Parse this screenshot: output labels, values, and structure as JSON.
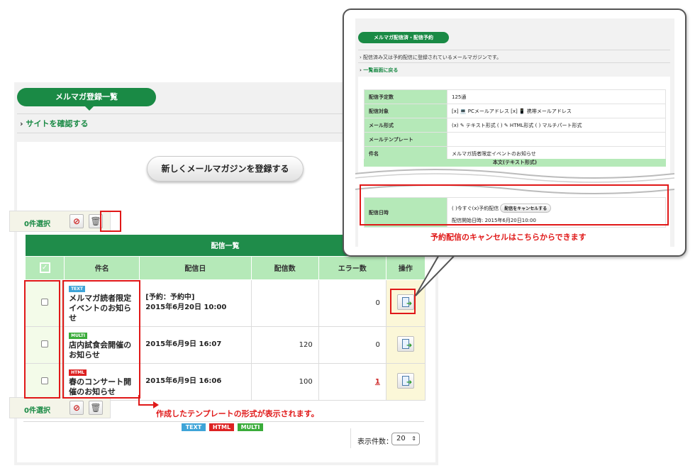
{
  "main": {
    "section_title": "メルマガ登録一覧",
    "site_link": "サイトを確認する",
    "register_button": "新しくメールマガジンを登録する",
    "selected_count_top": "0件選択",
    "selected_count_bottom": "0件選択",
    "table": {
      "title": "配信一覧",
      "headers": {
        "subject": "件名",
        "date": "配信日",
        "count": "配信数",
        "errors": "エラー数",
        "actions": "操作"
      },
      "rows": [
        {
          "badge": "TEXT",
          "subject": "メルマガ読者限定イベントのお知らせ",
          "date_line1": "[予約：予約中]",
          "date_line2": "2015年6月20日 10:00",
          "count": "",
          "errors": "0"
        },
        {
          "badge": "MULTI",
          "subject": "店内試食会開催のお知らせ",
          "date_line1": "2015年6月9日 16:07",
          "count": "120",
          "errors": "0"
        },
        {
          "badge": "HTML",
          "subject": "春のコンサート開催のお知らせ",
          "date_line1": "2015年6月9日 16:06",
          "count": "100",
          "errors": "1"
        }
      ]
    },
    "legend": {
      "text": "TEXT",
      "html": "HTML",
      "multi": "MULTI"
    },
    "page_size_label": "表示件数：",
    "page_size_value": "20",
    "annotation_template": "作成したテンプレートの形式が表示されます。"
  },
  "callout": {
    "section_title": "メルマガ配信済・配信予約",
    "description": "配信済み又は予約配信に登録されているメールマガジンです。",
    "back_link": "一覧画面に戻る",
    "rows": [
      {
        "label": "配信予定数",
        "value": "125通"
      },
      {
        "label": "配信対象",
        "value": "[x] 💻 PCメールアドレス [x] 📱 携帯メールアドレス"
      },
      {
        "label": "メール形式",
        "value": "(x) ✎ テキスト形式 ( ) ✎ HTML形式 ( ) マルチパート形式"
      },
      {
        "label": "メールテンプレート",
        "value": ""
      },
      {
        "label": "件名",
        "value": "メルマガ読者限定イベントのお知らせ"
      }
    ],
    "body_header": "本文(テキスト形式)",
    "send_label": "配信日時",
    "send_options": "( )今すぐ(x)予約配信",
    "cancel_button": "配信をキャンセルする",
    "send_start": "配信開始日時: 2015年6月20日10:00",
    "annotation_cancel": "予約配信のキャンセルはこちらからできます"
  },
  "colors": {
    "green": "#1a8a45",
    "light_green": "#b5e9b8",
    "red": "#e01818"
  }
}
